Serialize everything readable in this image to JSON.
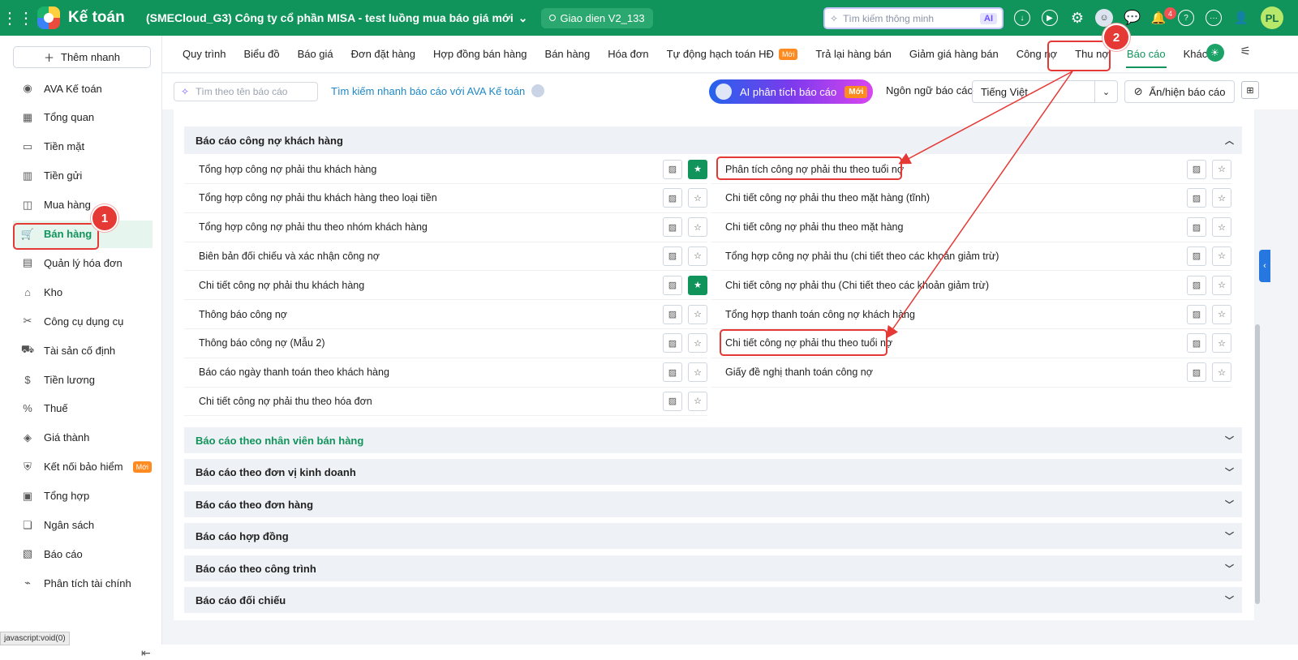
{
  "app": {
    "name": "Kế toán",
    "company": "(SMECloud_G3) Công ty cổ phần MISA - test luồng mua báo giá mới",
    "theme": "Giao dien V2_133",
    "search_placeholder": "Tìm kiếm thông minh",
    "search_badge": "AI",
    "notif_count": "4",
    "user_initials": "PL"
  },
  "sidebar": {
    "add_label": "Thêm nhanh",
    "items": [
      {
        "label": "AVA Kế toán",
        "icon": "ava-avatar-icon"
      },
      {
        "label": "Tổng quan",
        "icon": "dashboard-icon"
      },
      {
        "label": "Tiền mặt",
        "icon": "cash-icon"
      },
      {
        "label": "Tiền gửi",
        "icon": "bank-icon"
      },
      {
        "label": "Mua hàng",
        "icon": "shopping-bag-icon"
      },
      {
        "label": "Bán hàng",
        "icon": "cart-icon"
      },
      {
        "label": "Quản lý hóa đơn",
        "icon": "invoice-icon"
      },
      {
        "label": "Kho",
        "icon": "warehouse-icon"
      },
      {
        "label": "Công cụ dụng cụ",
        "icon": "tools-icon"
      },
      {
        "label": "Tài sản cố định",
        "icon": "truck-icon"
      },
      {
        "label": "Tiền lương",
        "icon": "salary-icon"
      },
      {
        "label": "Thuế",
        "icon": "tax-icon"
      },
      {
        "label": "Giá thành",
        "icon": "price-tag-icon"
      },
      {
        "label": "Kết nối bảo hiểm",
        "icon": "shield-icon",
        "badge": "Mới"
      },
      {
        "label": "Tổng hợp",
        "icon": "summary-icon"
      },
      {
        "label": "Ngân sách",
        "icon": "budget-icon"
      },
      {
        "label": "Báo cáo",
        "icon": "report-icon"
      },
      {
        "label": "Phân tích tài chính",
        "icon": "analytics-icon"
      }
    ],
    "status_url": "javascript:void(0)"
  },
  "tabs": [
    {
      "label": "Quy trình"
    },
    {
      "label": "Biểu đồ"
    },
    {
      "label": "Báo giá"
    },
    {
      "label": "Đơn đặt hàng"
    },
    {
      "label": "Hợp đồng bán hàng"
    },
    {
      "label": "Bán hàng"
    },
    {
      "label": "Hóa đơn"
    },
    {
      "label": "Tự động hạch toán HĐ",
      "badge": "Mới"
    },
    {
      "label": "Trả lại hàng bán"
    },
    {
      "label": "Giảm giá hàng bán"
    },
    {
      "label": "Công nợ"
    },
    {
      "label": "Thu nợ"
    },
    {
      "label": "Báo cáo"
    },
    {
      "label": "Khác"
    }
  ],
  "toolbar": {
    "search_placeholder": "Tìm theo tên báo cáo",
    "quick_ava": "Tìm kiếm nhanh báo cáo với AVA Kế toán",
    "ai_label": "AI phân tích báo cáo",
    "ai_badge": "Mới",
    "lang_label": "Ngôn ngữ báo cáo",
    "lang_value": "Tiếng Việt",
    "toggle_label": "Ẩn/hiện báo cáo"
  },
  "section_open": {
    "title": "Báo cáo công nợ khách hàng",
    "left": [
      {
        "label": "Tổng hợp công nợ phải thu khách hàng",
        "fav": true
      },
      {
        "label": "Tổng hợp công nợ phải thu khách hàng theo loại tiền",
        "fav": false
      },
      {
        "label": "Tổng hợp công nợ phải thu theo nhóm khách hàng",
        "fav": false
      },
      {
        "label": "Biên bản đối chiếu và xác nhận công nợ",
        "fav": false
      },
      {
        "label": "Chi tiết công nợ phải thu khách hàng",
        "fav": true
      },
      {
        "label": "Thông báo công nợ",
        "fav": false
      },
      {
        "label": "Thông báo công nợ (Mẫu 2)",
        "fav": false
      },
      {
        "label": "Báo cáo ngày thanh toán theo khách hàng",
        "fav": false
      },
      {
        "label": "Chi tiết công nợ phải thu theo hóa đơn",
        "fav": false
      }
    ],
    "right": [
      {
        "label": "Phân tích công nợ phải thu theo tuổi nợ",
        "fav": false
      },
      {
        "label": "Chi tiết công nợ phải thu theo mặt hàng (tĩnh)",
        "fav": false
      },
      {
        "label": "Chi tiết công nợ phải thu theo mặt hàng",
        "fav": false
      },
      {
        "label": "Tổng hợp công nợ phải thu (chi tiết theo các khoản giảm trừ)",
        "fav": false
      },
      {
        "label": "Chi tiết công nợ phải thu (Chi tiết theo các khoản giảm trừ)",
        "fav": false
      },
      {
        "label": "Tổng hợp thanh toán công nợ khách hàng",
        "fav": false
      },
      {
        "label": "Chi tiết công nợ phải thu theo tuổi nợ",
        "fav": false
      },
      {
        "label": "Giấy đề nghị thanh toán công nợ",
        "fav": false
      }
    ]
  },
  "sections_collapsed": [
    "Báo cáo theo nhân viên bán hàng",
    "Báo cáo theo đơn vị kinh doanh",
    "Báo cáo theo đơn hàng",
    "Báo cáo hợp đồng",
    "Báo cáo theo công trình",
    "Báo cáo đối chiếu"
  ],
  "markers": [
    "1",
    "2"
  ]
}
